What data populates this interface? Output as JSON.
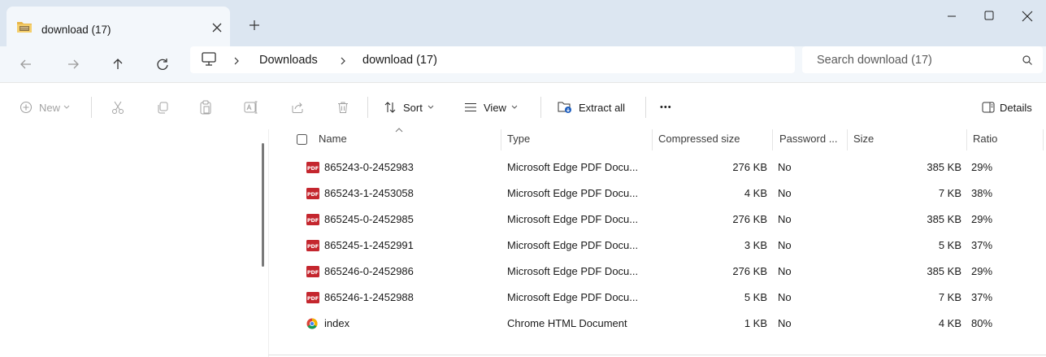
{
  "window": {
    "tab_title": "download (17)",
    "folder_icon": "folder-zip-icon",
    "accent": "#1f5fbf"
  },
  "address": {
    "crumbs": [
      "Downloads",
      "download (17)"
    ],
    "search_placeholder": "Search download (17)"
  },
  "commands": {
    "new": "New",
    "sort": "Sort",
    "view": "View",
    "extract_all": "Extract all",
    "more": "•••",
    "details": "Details"
  },
  "columns": [
    "Name",
    "Type",
    "Compressed size",
    "Password ...",
    "Size",
    "Ratio"
  ],
  "files": [
    {
      "name": "865243-0-2452983",
      "icon": "pdf-icon",
      "type": "Microsoft Edge PDF Docu...",
      "compressed": "276 KB",
      "password": "No",
      "size": "385 KB",
      "ratio": "29%"
    },
    {
      "name": "865243-1-2453058",
      "icon": "pdf-icon",
      "type": "Microsoft Edge PDF Docu...",
      "compressed": "4 KB",
      "password": "No",
      "size": "7 KB",
      "ratio": "38%"
    },
    {
      "name": "865245-0-2452985",
      "icon": "pdf-icon",
      "type": "Microsoft Edge PDF Docu...",
      "compressed": "276 KB",
      "password": "No",
      "size": "385 KB",
      "ratio": "29%"
    },
    {
      "name": "865245-1-2452991",
      "icon": "pdf-icon",
      "type": "Microsoft Edge PDF Docu...",
      "compressed": "3 KB",
      "password": "No",
      "size": "5 KB",
      "ratio": "37%"
    },
    {
      "name": "865246-0-2452986",
      "icon": "pdf-icon",
      "type": "Microsoft Edge PDF Docu...",
      "compressed": "276 KB",
      "password": "No",
      "size": "385 KB",
      "ratio": "29%"
    },
    {
      "name": "865246-1-2452988",
      "icon": "pdf-icon",
      "type": "Microsoft Edge PDF Docu...",
      "compressed": "5 KB",
      "password": "No",
      "size": "7 KB",
      "ratio": "37%"
    },
    {
      "name": "index",
      "icon": "chrome-html-icon",
      "type": "Chrome HTML Document",
      "compressed": "1 KB",
      "password": "No",
      "size": "4 KB",
      "ratio": "80%"
    }
  ]
}
